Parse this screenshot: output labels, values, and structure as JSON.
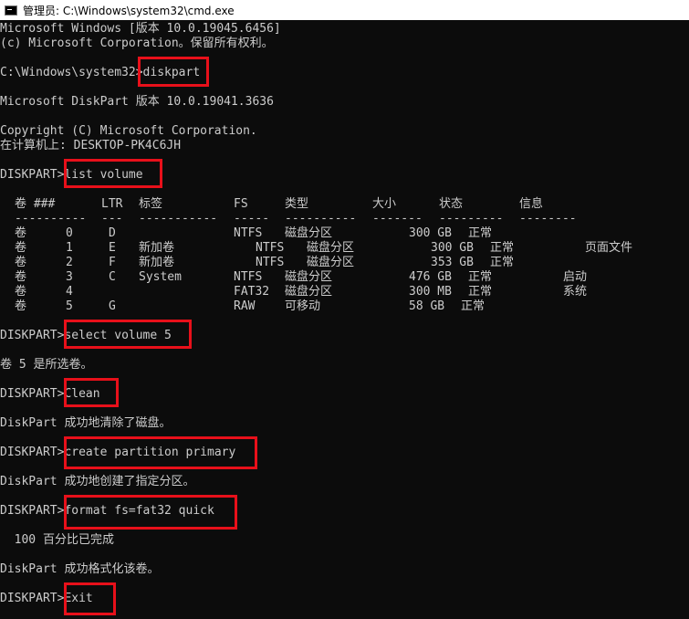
{
  "window": {
    "title": "管理员: C:\\Windows\\system32\\cmd.exe",
    "icon": "cmd-icon",
    "highlight_color": "#e8101a"
  },
  "header": {
    "line1": "Microsoft Windows [版本 10.0.19045.6456]",
    "line2": "(c) Microsoft Corporation。保留所有权利。"
  },
  "step1": {
    "prompt": "C:\\Windows\\system32>",
    "command": "diskpart"
  },
  "diskpart_info": {
    "version": "Microsoft DiskPart 版本 10.0.19041.3636",
    "copyright": "Copyright (C) Microsoft Corporation.",
    "computer": "在计算机上: DESKTOP-PK4C6JH"
  },
  "prompt": "DISKPART>",
  "step2": {
    "command": "list volume"
  },
  "volume_table": {
    "headers": [
      "卷 ###",
      "LTR",
      "标签",
      "FS",
      "类型",
      "大小",
      "状态",
      "信息"
    ],
    "separators": [
      "----------",
      "---",
      "-----------",
      "-----",
      "----------",
      "-------",
      "---------",
      "--------"
    ],
    "rows": [
      {
        "vol": "卷",
        "num": "0",
        "ltr": "D",
        "label": "",
        "fs": "NTFS",
        "type": "磁盘分区",
        "size": "300 GB",
        "status": "正常",
        "info": ""
      },
      {
        "vol": "卷",
        "num": "1",
        "ltr": "E",
        "label": "新加卷",
        "fs": "NTFS",
        "type": "磁盘分区",
        "size": "300 GB",
        "status": "正常",
        "info": "页面文件"
      },
      {
        "vol": "卷",
        "num": "2",
        "ltr": "F",
        "label": "新加卷",
        "fs": "NTFS",
        "type": "磁盘分区",
        "size": "353 GB",
        "status": "正常",
        "info": ""
      },
      {
        "vol": "卷",
        "num": "3",
        "ltr": "C",
        "label": "System",
        "fs": "NTFS",
        "type": "磁盘分区",
        "size": "476 GB",
        "status": "正常",
        "info": "启动"
      },
      {
        "vol": "卷",
        "num": "4",
        "ltr": "",
        "label": "",
        "fs": "FAT32",
        "type": "磁盘分区",
        "size": "300 MB",
        "status": "正常",
        "info": "系统"
      },
      {
        "vol": "卷",
        "num": "5",
        "ltr": "G",
        "label": "",
        "fs": "RAW",
        "type": "可移动",
        "size": "58 GB",
        "status": "正常",
        "info": ""
      }
    ]
  },
  "step3": {
    "command": "select volume 5",
    "result": "卷 5 是所选卷。"
  },
  "step4": {
    "command": "Clean",
    "result": "DiskPart 成功地清除了磁盘。"
  },
  "step5": {
    "command": "create partition primary",
    "result": "DiskPart 成功地创建了指定分区。"
  },
  "step6": {
    "command": "format fs=fat32 quick",
    "progress": "  100 百分比已完成",
    "result": "DiskPart 成功格式化该卷。"
  },
  "step7": {
    "command": "Exit"
  }
}
